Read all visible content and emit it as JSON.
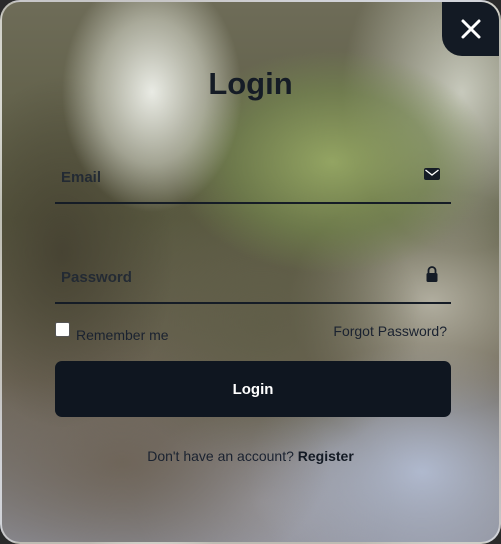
{
  "modal": {
    "title": "Login",
    "close_icon": "close-icon",
    "background_accent": "#131a24"
  },
  "form": {
    "email": {
      "placeholder": "Email",
      "value": "",
      "icon": "envelope-icon"
    },
    "password": {
      "placeholder": "Password",
      "value": "",
      "icon": "lock-icon"
    },
    "remember": {
      "label": "Remember me",
      "checked": false
    },
    "forgot_label": "Forgot Password?",
    "submit_label": "Login",
    "submit_color": "#0f1620"
  },
  "footer": {
    "prompt": "Don't have an account?",
    "register_label": "Register"
  }
}
